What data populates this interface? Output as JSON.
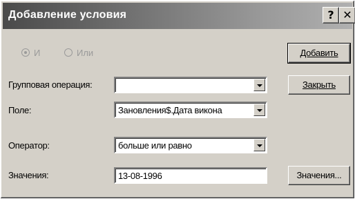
{
  "window": {
    "title": "Добавление условия"
  },
  "titlebar_buttons": {
    "help": "?",
    "close": "✕"
  },
  "logic": {
    "and_label": "И",
    "or_label": "Или",
    "selected": "И"
  },
  "group_operation": {
    "label": "Групповая операция:",
    "value": ""
  },
  "field": {
    "label": "Поле:",
    "value": "Зановления$.Дата викона"
  },
  "operator": {
    "label": "Оператор:",
    "value": "больше или равно"
  },
  "value": {
    "label": "Значения:",
    "value": "13-08-1996"
  },
  "buttons": {
    "add": "Добавить",
    "close": "Закрыть",
    "values": "Значения..."
  }
}
